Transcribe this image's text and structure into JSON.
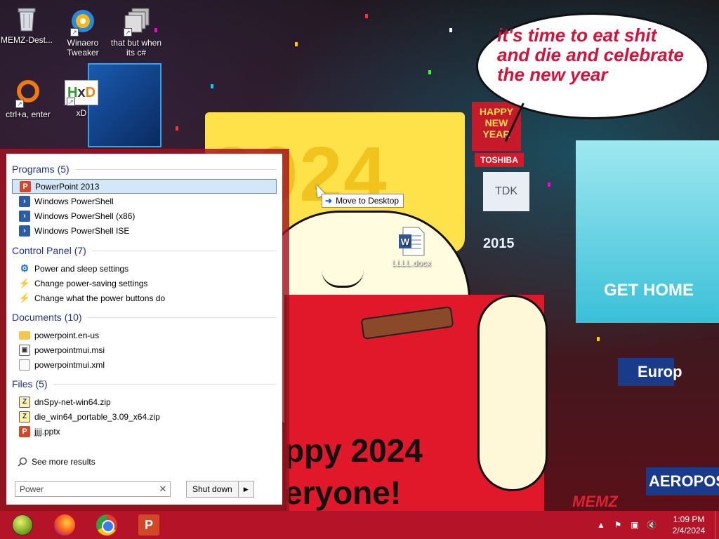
{
  "wallpaper": {
    "bubble_text": [
      "it's time to eat shit",
      "and die and celebrate",
      "the new year"
    ],
    "hat_year": "2024",
    "shirt_text": [
      "ppy 2024",
      "eryone!"
    ],
    "signature": "MEMZ",
    "billboard_texts": [
      "HAPPY NEW YEAR",
      "TOSHIBA",
      "TDK",
      "2015",
      "GET HOME",
      "Europ",
      "AEROPOS"
    ]
  },
  "desktop_icons": [
    {
      "label": "MEMZ-Dest...",
      "icon": "recycle-bin-icon"
    },
    {
      "label": "Winaero Tweaker",
      "icon": "winaero-icon"
    },
    {
      "label": "that but when its c#",
      "icon": "stack-icon"
    },
    {
      "label": "ctrl+a, enter",
      "icon": "ring-icon"
    },
    {
      "label": "xD",
      "icon": "hxd-icon"
    },
    {
      "label": "LLLL.docx",
      "icon": "word-doc-icon"
    }
  ],
  "drag_tooltip": {
    "arrow": "➜",
    "text": "Move to Desktop"
  },
  "start_menu": {
    "groups": [
      {
        "title": "Programs (5)",
        "items": [
          {
            "label": "PowerPoint 2013",
            "icon": "powerpoint-icon"
          },
          {
            "label": "Windows PowerShell",
            "icon": "powershell-icon"
          },
          {
            "label": "Windows PowerShell (x86)",
            "icon": "powershell-icon"
          },
          {
            "label": "Windows PowerShell ISE",
            "icon": "powershell-icon"
          }
        ]
      },
      {
        "title": "Control Panel (7)",
        "items": [
          {
            "label": "Power and sleep settings",
            "icon": "gear-icon"
          },
          {
            "label": "Change power-saving settings",
            "icon": "power-options-icon"
          },
          {
            "label": "Change what the power buttons do",
            "icon": "power-options-icon"
          }
        ]
      },
      {
        "title": "Documents (10)",
        "items": [
          {
            "label": "powerpoint.en-us",
            "icon": "folder-icon"
          },
          {
            "label": "powerpointmui.msi",
            "icon": "msi-icon"
          },
          {
            "label": "powerpointmui.xml",
            "icon": "file-icon"
          }
        ]
      },
      {
        "title": "Files (5)",
        "items": [
          {
            "label": "dnSpy-net-win64.zip",
            "icon": "zip-icon"
          },
          {
            "label": "die_win64_portable_3.09_x64.zip",
            "icon": "zip-icon"
          },
          {
            "label": "jjjj.pptx",
            "icon": "pptx-icon"
          }
        ]
      }
    ],
    "see_more": "See more results",
    "search_value": "Power",
    "shutdown_label": "Shut down"
  },
  "taskbar": {
    "pinned": [
      "start-orb",
      "firefox",
      "chrome",
      "powerpoint"
    ],
    "tray_icons": [
      "show-hidden-icons",
      "flag-icon",
      "network-icon",
      "volume-muted-icon"
    ],
    "time": "1:09 PM",
    "date": "2/4/2024"
  }
}
